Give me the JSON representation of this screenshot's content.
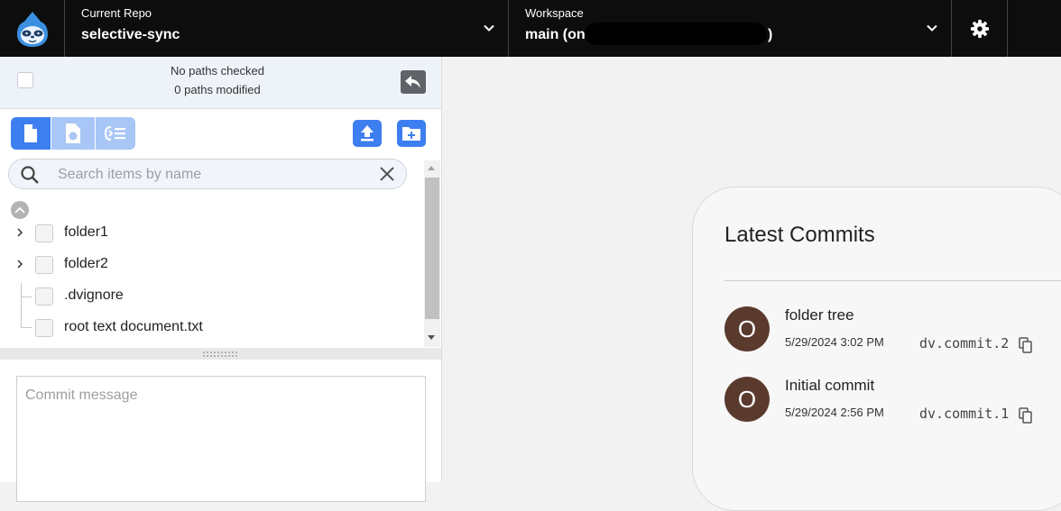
{
  "header": {
    "repo_label": "Current Repo",
    "repo_name": "selective-sync",
    "workspace_label": "Workspace",
    "workspace_value": "main (on",
    "workspace_value_close": ")"
  },
  "summary": {
    "checked": "No paths checked",
    "modified": "0 paths modified"
  },
  "search": {
    "placeholder": "Search items by name"
  },
  "tree": {
    "items": [
      {
        "label": "folder1",
        "expandable": true
      },
      {
        "label": "folder2",
        "expandable": true
      },
      {
        "label": ".dvignore",
        "expandable": false
      },
      {
        "label": "root text document.txt",
        "expandable": false
      }
    ]
  },
  "commit": {
    "placeholder": "Commit message"
  },
  "commits_panel": {
    "title": "Latest Commits",
    "items": [
      {
        "avatar": "O",
        "message": "folder tree",
        "date": "5/29/2024 3:02 PM",
        "id": "dv.commit.2"
      },
      {
        "avatar": "O",
        "message": "Initial commit",
        "date": "5/29/2024 2:56 PM",
        "id": "dv.commit.1"
      }
    ]
  },
  "colors": {
    "accent": "#3d7ef0",
    "avatar": "#5b3a2e",
    "topbar": "#0d0d0d"
  }
}
